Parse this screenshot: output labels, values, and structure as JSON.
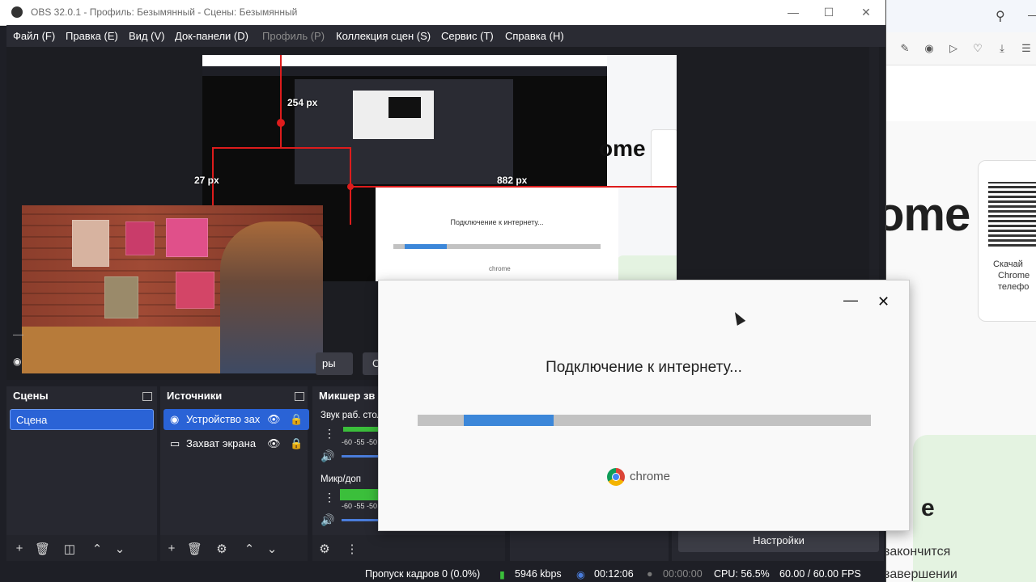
{
  "obs": {
    "window_title": "OBS 32.0.1 - Профиль: Безымянный - Сцены: Безымянный",
    "menu": [
      "Файл (F)",
      "Правка (E)",
      "Вид (V)",
      "Док-панели (D)",
      "Профиль (P)",
      "Коллекция сцен (S)",
      "Сервис (T)",
      "Справка (H)"
    ],
    "preview_labels": {
      "px_top": "254 px",
      "px_left": "27 px",
      "px_right": "882 px"
    },
    "dock_scenes": {
      "title": "Сцены",
      "items": [
        "Сцена"
      ]
    },
    "dock_sources": {
      "title": "Источники",
      "items": [
        "Устройство зах",
        "Захват экрана"
      ]
    },
    "dock_mixer": {
      "title": "Микшер зв",
      "channels": [
        {
          "name": "Звук раб. стол",
          "scale": "-60 -55 -50"
        },
        {
          "name": "Микр/доп",
          "scale": "-60 -55 -50"
        }
      ]
    },
    "controls_partial": [
      "ры",
      "С"
    ],
    "settings_button": "Настройки",
    "status": {
      "dropped_frames": "Пропуск кадров 0 (0.0%)",
      "bitrate": "5946 kbps",
      "stream_time": "00:12:06",
      "rec_time": "00:00:00",
      "cpu": "CPU: 56.5%",
      "fps": "60.00 / 60.00 FPS"
    },
    "accent_color": "#2a63d6"
  },
  "installer": {
    "message": "Подключение к интернету...",
    "progress": 0.2,
    "brand": "chrome",
    "minimize_icon": "minimize-icon",
    "close_icon": "close-icon"
  },
  "browser_bg": {
    "big_text": "ome",
    "qr_caption": [
      "Скачай",
      "Chrome",
      "телефо"
    ],
    "footer_text": [
      "закончится",
      "завершении"
    ],
    "green_card_text": "e"
  }
}
